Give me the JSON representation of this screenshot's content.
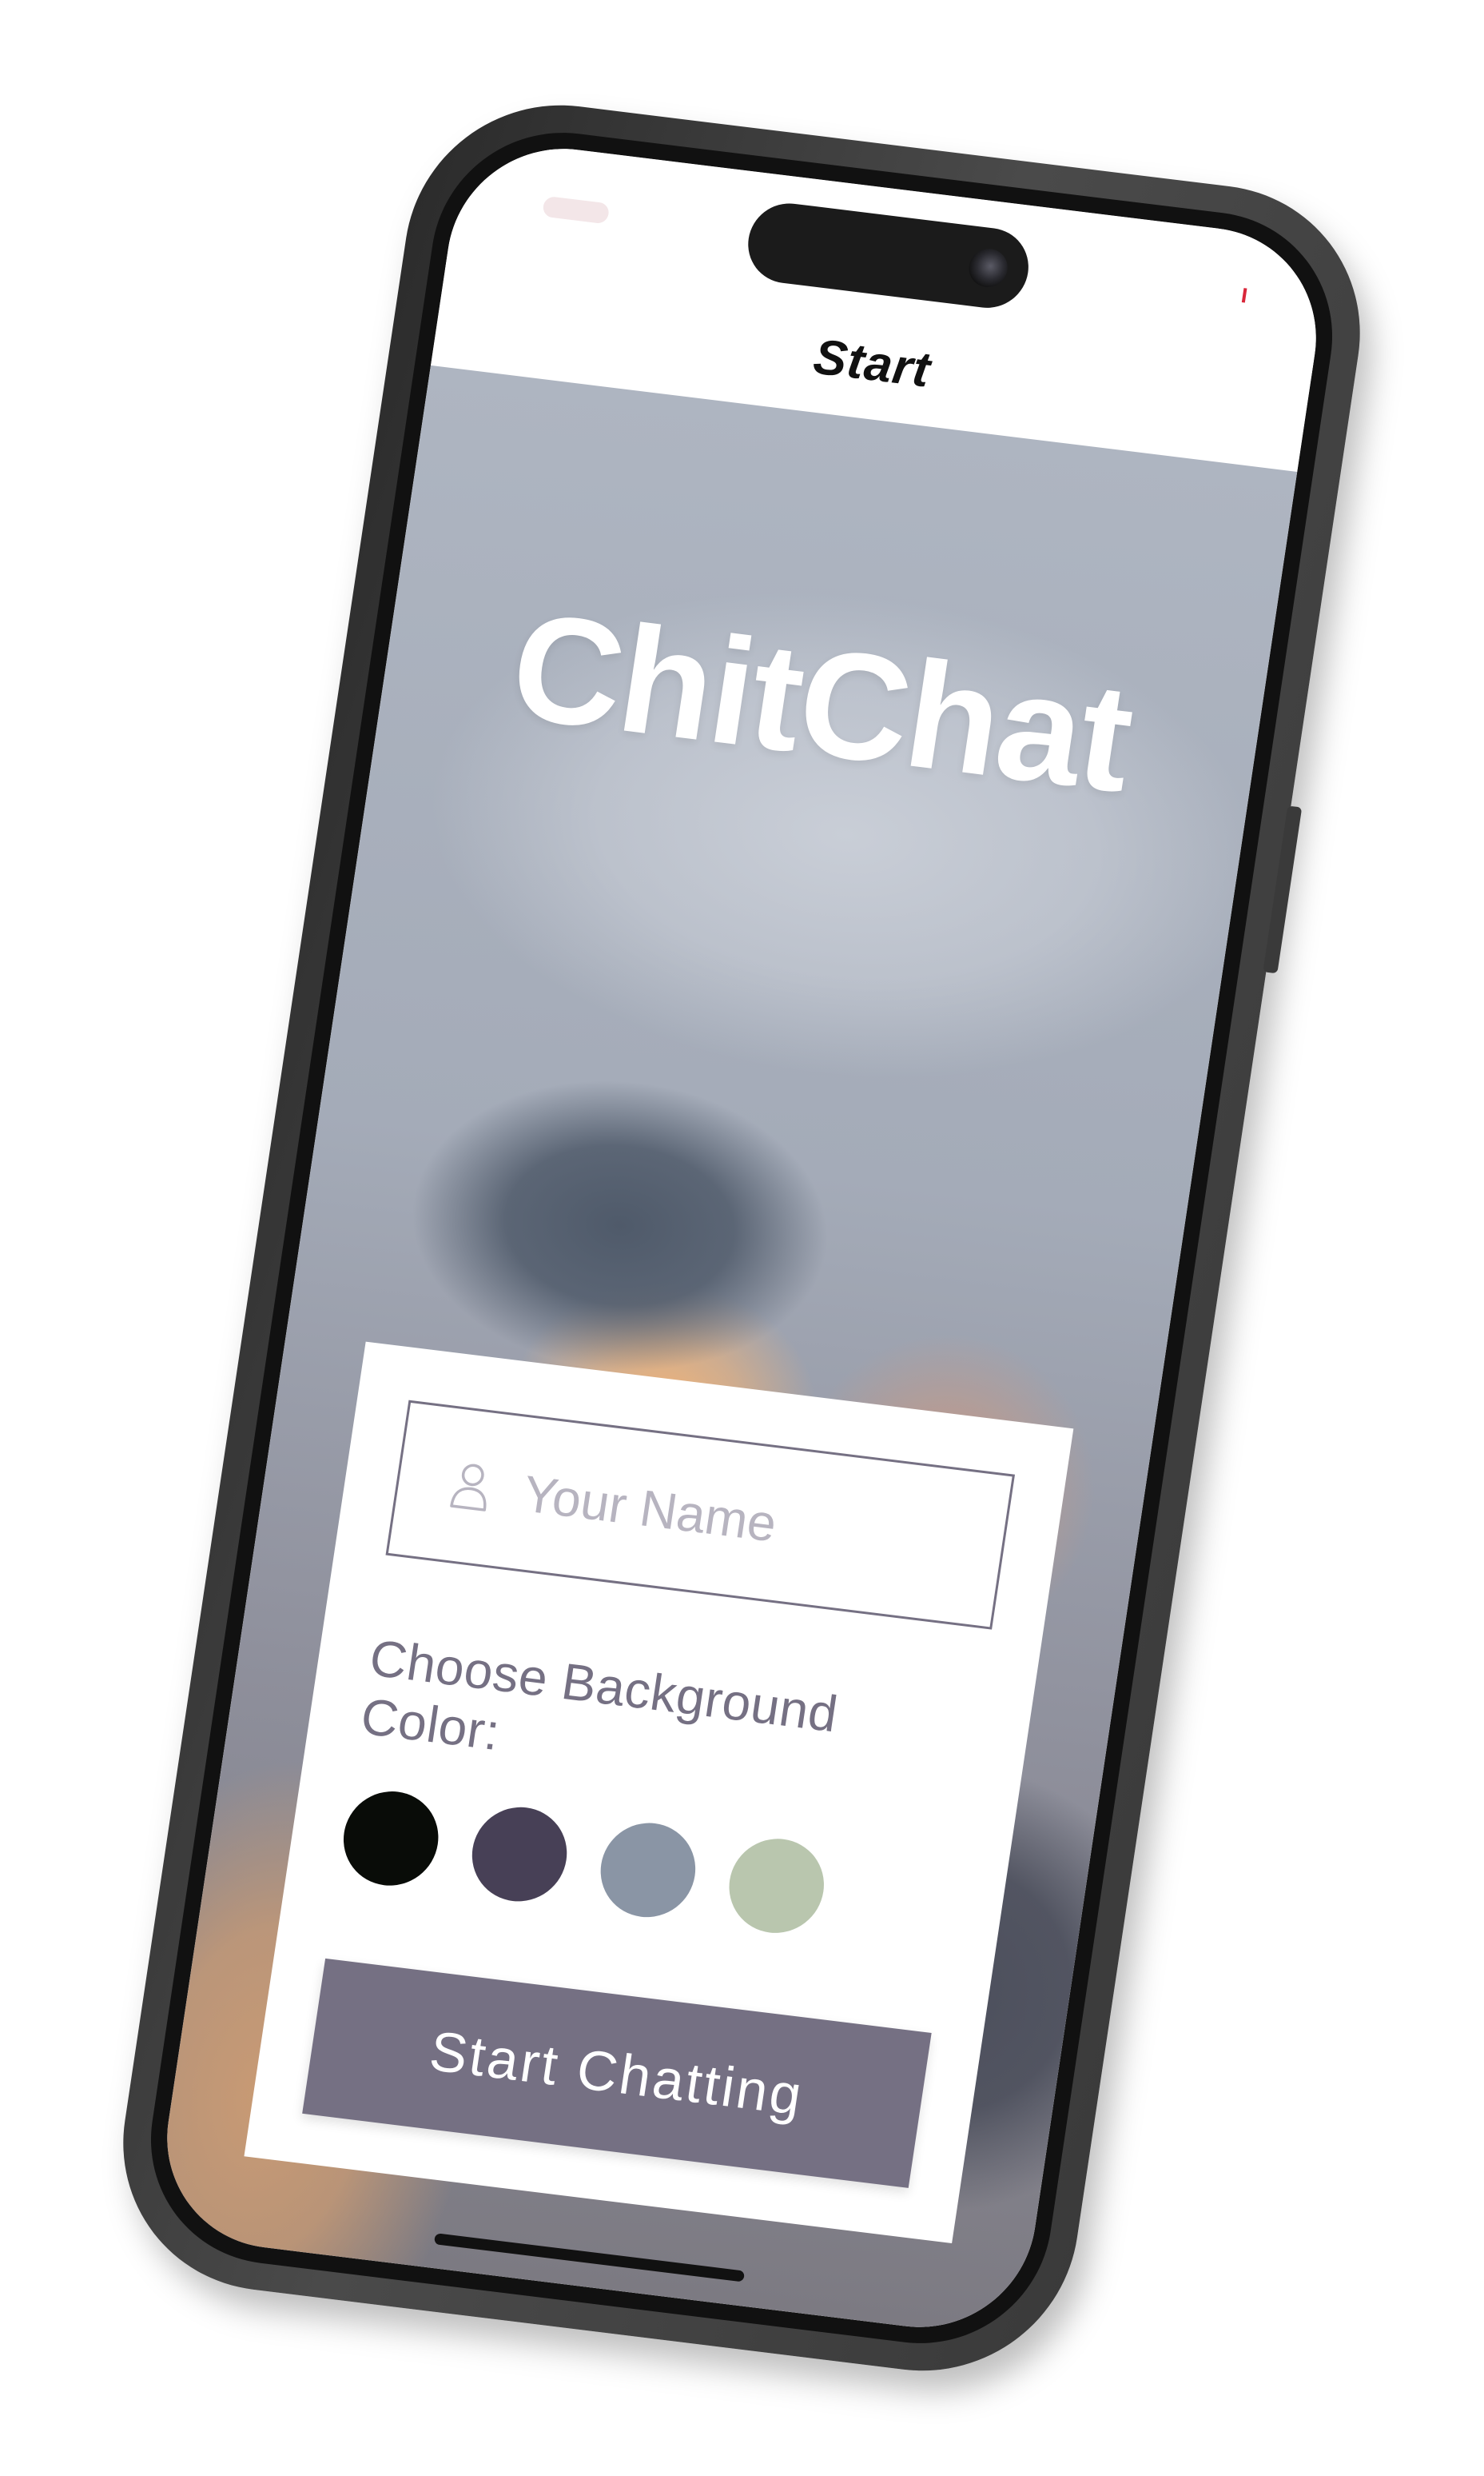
{
  "nav": {
    "title": "Start"
  },
  "app": {
    "title": "ChitChat"
  },
  "form": {
    "name_placeholder": "Your Name",
    "name_value": "",
    "color_label": "Choose Background Color:",
    "colors": [
      "#090C08",
      "#474056",
      "#8A95A5",
      "#B9C6AE"
    ],
    "start_button_label": "Start Chatting"
  },
  "theme": {
    "accent": "#757083",
    "text": "#757083"
  },
  "icons": {
    "name_field": "person-icon"
  }
}
